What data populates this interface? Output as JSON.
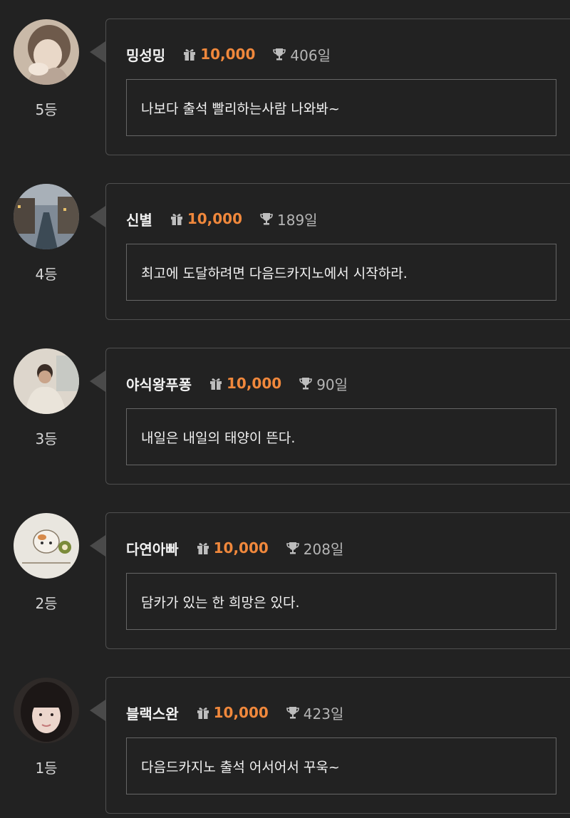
{
  "entries": [
    {
      "nickname": "밍성밍",
      "points": "10,000",
      "days": "406일",
      "message": "나보다 출석 빨리하는사람 나와봐~",
      "rank": "5등"
    },
    {
      "nickname": "신별",
      "points": "10,000",
      "days": "189일",
      "message": "최고에 도달하려면 다음드카지노에서 시작하라.",
      "rank": "4등"
    },
    {
      "nickname": "야식왕푸퐁",
      "points": "10,000",
      "days": "90일",
      "message": "내일은 내일의 태양이 뜬다.",
      "rank": "3등"
    },
    {
      "nickname": "다연아빠",
      "points": "10,000",
      "days": "208일",
      "message": "담카가 있는 한 희망은 있다.",
      "rank": "2등"
    },
    {
      "nickname": "블랙스완",
      "points": "10,000",
      "days": "423일",
      "message": "다음드카지노 출석 어서어서 꾸욱~",
      "rank": "1등"
    }
  ],
  "colors": {
    "background": "#222222",
    "points_accent": "#f0883c",
    "card_border": "#4f4f4f"
  },
  "icons": {
    "points": "gift-icon",
    "days": "trophy-icon"
  }
}
